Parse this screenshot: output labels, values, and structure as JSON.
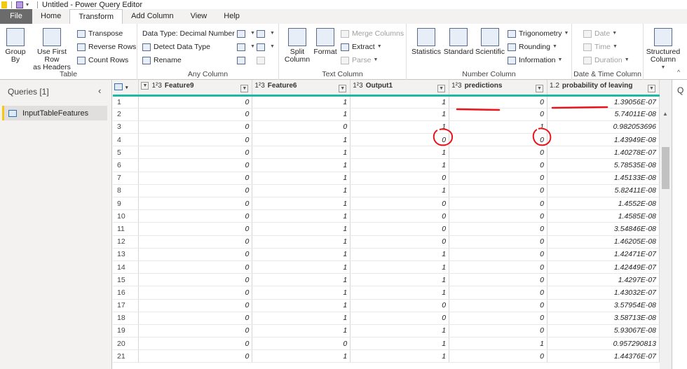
{
  "window": {
    "title": "Untitled - Power Query Editor"
  },
  "tabs": [
    {
      "label": "File"
    },
    {
      "label": "Home"
    },
    {
      "label": "Transform"
    },
    {
      "label": "Add Column"
    },
    {
      "label": "View"
    },
    {
      "label": "Help"
    }
  ],
  "ribbon": {
    "table": {
      "label": "Table",
      "group_by": "Group\nBy",
      "use_first_row": "Use First Row\nas Headers",
      "transpose": "Transpose",
      "reverse_rows": "Reverse Rows",
      "count_rows": "Count Rows"
    },
    "any_column": {
      "label": "Any Column",
      "data_type": "Data Type: Decimal Number",
      "detect_type": "Detect Data Type",
      "rename": "Rename"
    },
    "text_column": {
      "label": "Text Column",
      "split_column": "Split\nColumn",
      "format": "Format",
      "merge_columns": "Merge Columns",
      "extract": "Extract",
      "parse": "Parse"
    },
    "number_column": {
      "label": "Number Column",
      "statistics": "Statistics",
      "standard": "Standard",
      "scientific": "Scientific",
      "trigonometry": "Trigonometry",
      "rounding": "Rounding",
      "information": "Information"
    },
    "datetime": {
      "label": "Date & Time Column",
      "date": "Date",
      "time": "Time",
      "duration": "Duration"
    },
    "structured": {
      "label": "Structured\nColumn"
    }
  },
  "queries": {
    "header": "Queries [1]",
    "items": [
      {
        "label": "InputTableFeatures"
      }
    ]
  },
  "grid": {
    "columns": [
      {
        "type": "1²3",
        "name": "Feature9"
      },
      {
        "type": "1²3",
        "name": "Feature6"
      },
      {
        "type": "1²3",
        "name": "Output1"
      },
      {
        "type": "1²3",
        "name": "predictions"
      },
      {
        "type": "1.2",
        "name": "probability of leaving"
      }
    ],
    "rows": [
      [
        "",
        "0",
        "1",
        "1",
        "0",
        "1.39056E-07"
      ],
      [
        "",
        "0",
        "1",
        "1",
        "0",
        "5.74011E-08"
      ],
      [
        "",
        "0",
        "0",
        "1",
        "1",
        "0.982053696"
      ],
      [
        "",
        "0",
        "1",
        "0",
        "0",
        "1.43949E-08"
      ],
      [
        "",
        "0",
        "1",
        "1",
        "0",
        "1.40278E-07"
      ],
      [
        "",
        "0",
        "1",
        "1",
        "0",
        "5.78535E-08"
      ],
      [
        "",
        "0",
        "1",
        "0",
        "0",
        "1.45133E-08"
      ],
      [
        "",
        "0",
        "1",
        "1",
        "0",
        "5.82411E-08"
      ],
      [
        "",
        "0",
        "1",
        "0",
        "0",
        "1.4552E-08"
      ],
      [
        "",
        "0",
        "1",
        "0",
        "0",
        "1.4585E-08"
      ],
      [
        "",
        "0",
        "1",
        "0",
        "0",
        "3.54846E-08"
      ],
      [
        "",
        "0",
        "1",
        "0",
        "0",
        "1.46205E-08"
      ],
      [
        "",
        "0",
        "1",
        "1",
        "0",
        "1.42471E-07"
      ],
      [
        "",
        "0",
        "1",
        "1",
        "0",
        "1.42449E-07"
      ],
      [
        "",
        "0",
        "1",
        "1",
        "0",
        "1.4297E-07"
      ],
      [
        "",
        "0",
        "1",
        "1",
        "0",
        "1.43032E-07"
      ],
      [
        "",
        "0",
        "1",
        "0",
        "0",
        "3.57954E-08"
      ],
      [
        "",
        "0",
        "1",
        "0",
        "0",
        "3.58713E-08"
      ],
      [
        "",
        "0",
        "1",
        "1",
        "0",
        "5.93067E-08"
      ],
      [
        "",
        "0",
        "0",
        "1",
        "1",
        "0.957290813"
      ],
      [
        "",
        "0",
        "1",
        "1",
        "0",
        "1.44376E-07"
      ]
    ]
  },
  "annotation_color": "#e8141b",
  "accent": "#1fb7a5"
}
